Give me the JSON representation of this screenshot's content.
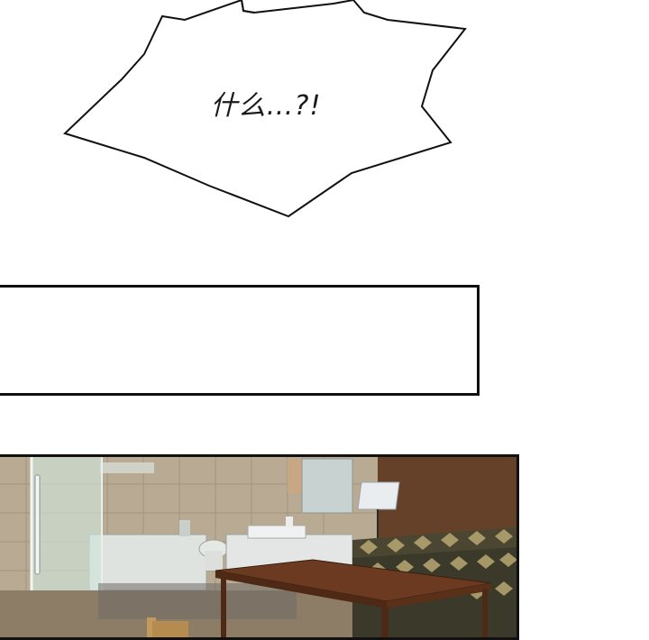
{
  "speech_bubble": {
    "text": "什么…?!"
  },
  "caption_box": {
    "text": ""
  },
  "scene": {
    "colors": {
      "wall_tile": "#b9ab93",
      "glass": "#cfe3dc",
      "wood_wall": "#5a3a25",
      "sofa_pattern_dark": "#3b3a2a",
      "sofa_pattern_light": "#b9a873",
      "table_wood": "#6b3a20",
      "floor": "#8d7c66"
    }
  }
}
